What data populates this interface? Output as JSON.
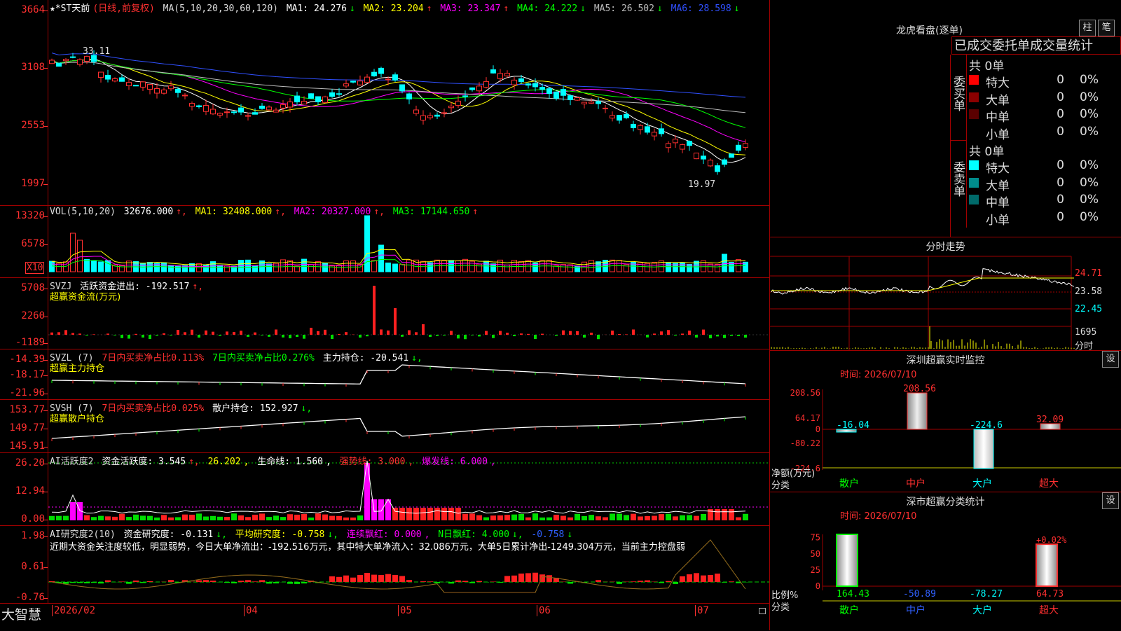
{
  "kline": {
    "title": "★*ST天前",
    "mode": "(日线,前复权)",
    "ma_label": "MA(5,10,20,30,60,120)",
    "ma1": "MA1: 24.276",
    "ma2": "MA2: 23.204",
    "ma3": "MA3: 23.347",
    "ma4": "MA4: 24.222",
    "ma5": "MA5: 26.502",
    "ma6": "MA6: 28.598",
    "yticks": [
      "3664",
      "3108",
      "2553",
      "1997"
    ],
    "high_label": "33.11",
    "low_label": "19.97"
  },
  "vol": {
    "label": "VOL(5,10,20)",
    "value": "32676.000",
    "ma1": "MA1: 32408.000",
    "ma2": "MA2: 20327.000",
    "ma3": "MA3: 17144.650",
    "yticks": [
      "13320",
      "6578"
    ],
    "unit": "X10"
  },
  "svzj": {
    "label": "SVZJ",
    "text": "活跃资金进出: -192.517",
    "sub": "超赢资金流(万元)",
    "yticks": [
      "5708",
      "2260",
      "-1189"
    ]
  },
  "svzl": {
    "label": "SVZL (7)",
    "t1": "7日内买卖净占比0.113%",
    "t2": "7日内买卖净占比0.276%",
    "t3": "主力持仓: -20.541",
    "sub": "超赢主力持仓",
    "yticks": [
      "-14.39",
      "-18.17",
      "-21.96"
    ]
  },
  "svsh": {
    "label": "SVSH (7)",
    "t1": "7日内买卖净占比0.025%",
    "t2": "散户持仓: 152.927",
    "sub": "超赢散户持仓",
    "yticks": [
      "153.77",
      "149.77",
      "145.91"
    ]
  },
  "ai1": {
    "label": "AI活跃度2",
    "t1": "资金活跃度: 3.545",
    "t2": "26.202",
    "t3": "生命线: 1.560",
    "t4": "强势线: 3.000",
    "t5": "爆发线: 6.000",
    "yticks": [
      "26.20",
      "12.94",
      "0.00"
    ]
  },
  "ai2": {
    "label": "AI研究度2(10)",
    "t1": "资金研究度: -0.131",
    "t2": "平均研究度: -0.758",
    "t3": "连续飘红: 0.000",
    "t4": "N日飘红: 4.000",
    "t5": "-0.758",
    "comment": "近期大资金关注度较低，明显弱势，今日大单净流出：-192.516万元，其中特大单净流入：32.086万元，大单5日累计净出-1249.304万元，当前主力控盘弱",
    "yticks": [
      "1.98",
      "0.61",
      "-0.76"
    ]
  },
  "xaxis": {
    "brand": "大智慧",
    "labels": [
      "2026/02",
      "04",
      "05",
      "06",
      "07"
    ]
  },
  "lhb": {
    "title": "龙虎看盘(逐单)",
    "btn1": "柱",
    "btn2": "笔",
    "header": "已成交委托单成交量统计",
    "buy": {
      "side": "委买单",
      "total": "共 0单",
      "rows": [
        {
          "name": "特大",
          "n": "0",
          "p": "0%",
          "color": "#ff0000"
        },
        {
          "name": "大单",
          "n": "0",
          "p": "0%",
          "color": "#8b0000"
        },
        {
          "name": "中单",
          "n": "0",
          "p": "0%",
          "color": "#5a0000"
        },
        {
          "name": "小单",
          "n": "0",
          "p": "0%",
          "color": ""
        }
      ]
    },
    "sell": {
      "side": "委卖单",
      "total": "共 0单",
      "rows": [
        {
          "name": "特大",
          "n": "0",
          "p": "0%",
          "color": "#00ffff"
        },
        {
          "name": "大单",
          "n": "0",
          "p": "0%",
          "color": "#008b8b"
        },
        {
          "name": "中单",
          "n": "0",
          "p": "0%",
          "color": "#006a6a"
        },
        {
          "name": "小单",
          "n": "0",
          "p": "0%",
          "color": ""
        }
      ]
    }
  },
  "fenshi": {
    "title": "分时走势",
    "p1": "24.71",
    "p2": "23.58",
    "p3": "22.45",
    "v": "1695",
    "unit": "分时"
  },
  "monitor": {
    "title": "深圳超赢实时监控",
    "btn": "设",
    "time": "时间: 2026/07/10",
    "yticks": [
      "208.56",
      "64.17",
      "0",
      "-80.22",
      "-224.6"
    ],
    "ylabel": "净额(万元)",
    "xlabel": "分类",
    "categories": [
      "散户",
      "中户",
      "大户",
      "超大"
    ],
    "values": [
      -16.04,
      208.56,
      -224.6,
      32.09
    ],
    "value_labels": [
      "-16.04",
      "208.56",
      "-224.6",
      "32.09"
    ]
  },
  "classify": {
    "title": "深市超赢分类统计",
    "btn": "设",
    "time": "时间: 2026/07/10",
    "yticks": [
      "75",
      "50",
      "25",
      "0"
    ],
    "ylabel": "比例%",
    "xlabel": "分类",
    "categories": [
      "散户",
      "中户",
      "大户",
      "超大"
    ],
    "values": [
      164.43,
      -50.89,
      -78.27,
      64.73
    ],
    "value_labels": [
      "164.43",
      "-50.89",
      "-78.27",
      "64.73"
    ],
    "pct_label": "+0.02%"
  },
  "colors": {
    "up": "#ff3030",
    "down": "#00ffff",
    "grid": "#a00000",
    "yellow": "#ffff00"
  }
}
